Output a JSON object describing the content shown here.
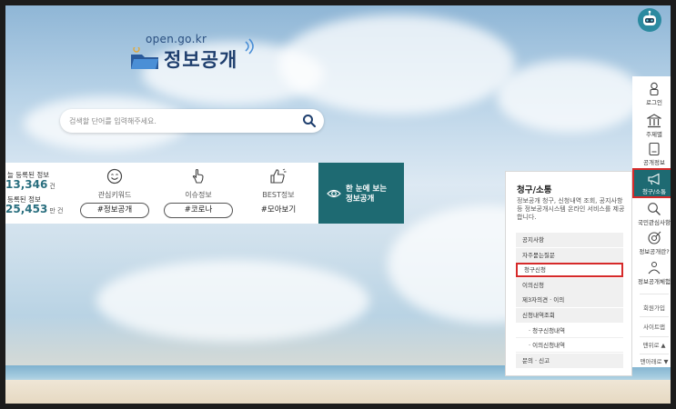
{
  "logo": {
    "domain": "open.go.kr",
    "title": "정보공개"
  },
  "search": {
    "placeholder": "검색할 단어를 입력해주세요."
  },
  "stats": {
    "line1_label": "늘 등록된 정보",
    "line1_value": "13,346",
    "line1_unit": "건",
    "line2_label": "등록된 정보",
    "line2_value": "25,453",
    "line2_unit": "만 건"
  },
  "keywords": [
    {
      "label": "관심키워드",
      "tag": "#정보공개",
      "boxed": true
    },
    {
      "label": "이슈정보",
      "tag": "#코로나",
      "boxed": true
    },
    {
      "label": "BEST정보",
      "tag": "#모아보기",
      "boxed": false
    }
  ],
  "overview": {
    "line1": "한 눈에 보는",
    "line2": "정보공개"
  },
  "panel": {
    "title": "청구/소통",
    "description": "정보공개 청구, 신청내역 조회, 공지사항 등 정보공개시스템 온라인 서비스를 제공합니다.",
    "items": [
      {
        "label": "공지사항",
        "sub": false,
        "highlight": false
      },
      {
        "label": "자주묻는질문",
        "sub": false,
        "highlight": false
      },
      {
        "label": "청구신청",
        "sub": false,
        "highlight": true
      },
      {
        "label": "이의신청",
        "sub": false,
        "highlight": false
      },
      {
        "label": "제3자의견 · 이의",
        "sub": false,
        "highlight": false
      },
      {
        "label": "신청내역조회",
        "sub": false,
        "highlight": false
      },
      {
        "label": "· 청구신청내역",
        "sub": true,
        "highlight": false
      },
      {
        "label": "· 이의신청내역",
        "sub": true,
        "highlight": false
      },
      {
        "label": "문의 · 신고",
        "sub": false,
        "highlight": false
      }
    ]
  },
  "sidebar": {
    "login": "로그인",
    "by_org": "주제별",
    "open_info": "공개정보",
    "request": "청구/소통",
    "national_interest": "국민관심사항",
    "what_is": "정보공개란?",
    "experience": "정보공개체험",
    "join": "회원가입",
    "sitemap": "사이트맵",
    "menu_open": "맨위로 ▲",
    "menu_down": "맨아래로 ▼"
  },
  "colors": {
    "accent": "#1e6a72",
    "highlight": "#d62a2a",
    "number": "#2a6f7f"
  }
}
